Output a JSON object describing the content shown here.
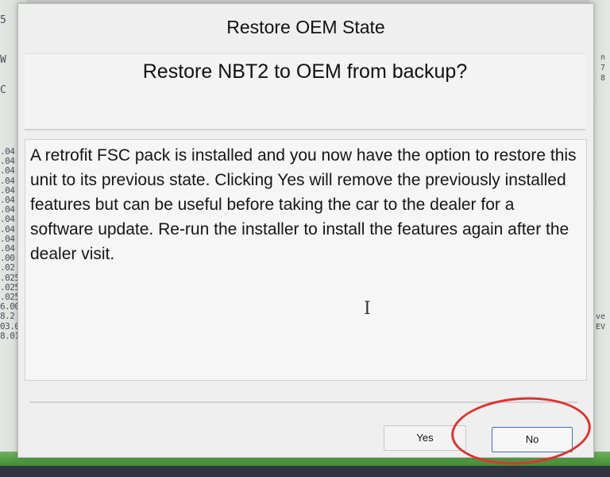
{
  "background": {
    "left_top_texts": [
      "5",
      "W",
      "C"
    ],
    "left_column_texts": [
      ".04",
      ".04",
      ".04",
      ".04",
      ".04",
      ".04",
      ".04",
      ".04",
      ".04",
      ".04",
      ".04",
      ".00",
      ".02",
      ".025",
      ".025",
      ".025",
      "6.00",
      "8.2",
      "03.0",
      "8.01"
    ],
    "right_top_texts": [
      "n",
      "7",
      "8"
    ],
    "right_mid_texts": [
      "ve",
      "EV"
    ]
  },
  "dialog": {
    "title": "Restore OEM State",
    "question": "Restore NBT2 to OEM from backup?",
    "message": "A retrofit FSC pack is installed and you now have the option to restore this unit to its previous state. Clicking Yes will remove the previously installed features but can be useful before taking the car to the dealer for a software update. Re-run the installer to install the features again after the dealer visit.",
    "yes_label": "Yes",
    "no_label": "No",
    "cursor_icon": "text-cursor-icon"
  },
  "colors": {
    "annotation_circle": "#e0322e",
    "focus_border": "#3d6fb8",
    "green_strip": "#4f9c40"
  }
}
